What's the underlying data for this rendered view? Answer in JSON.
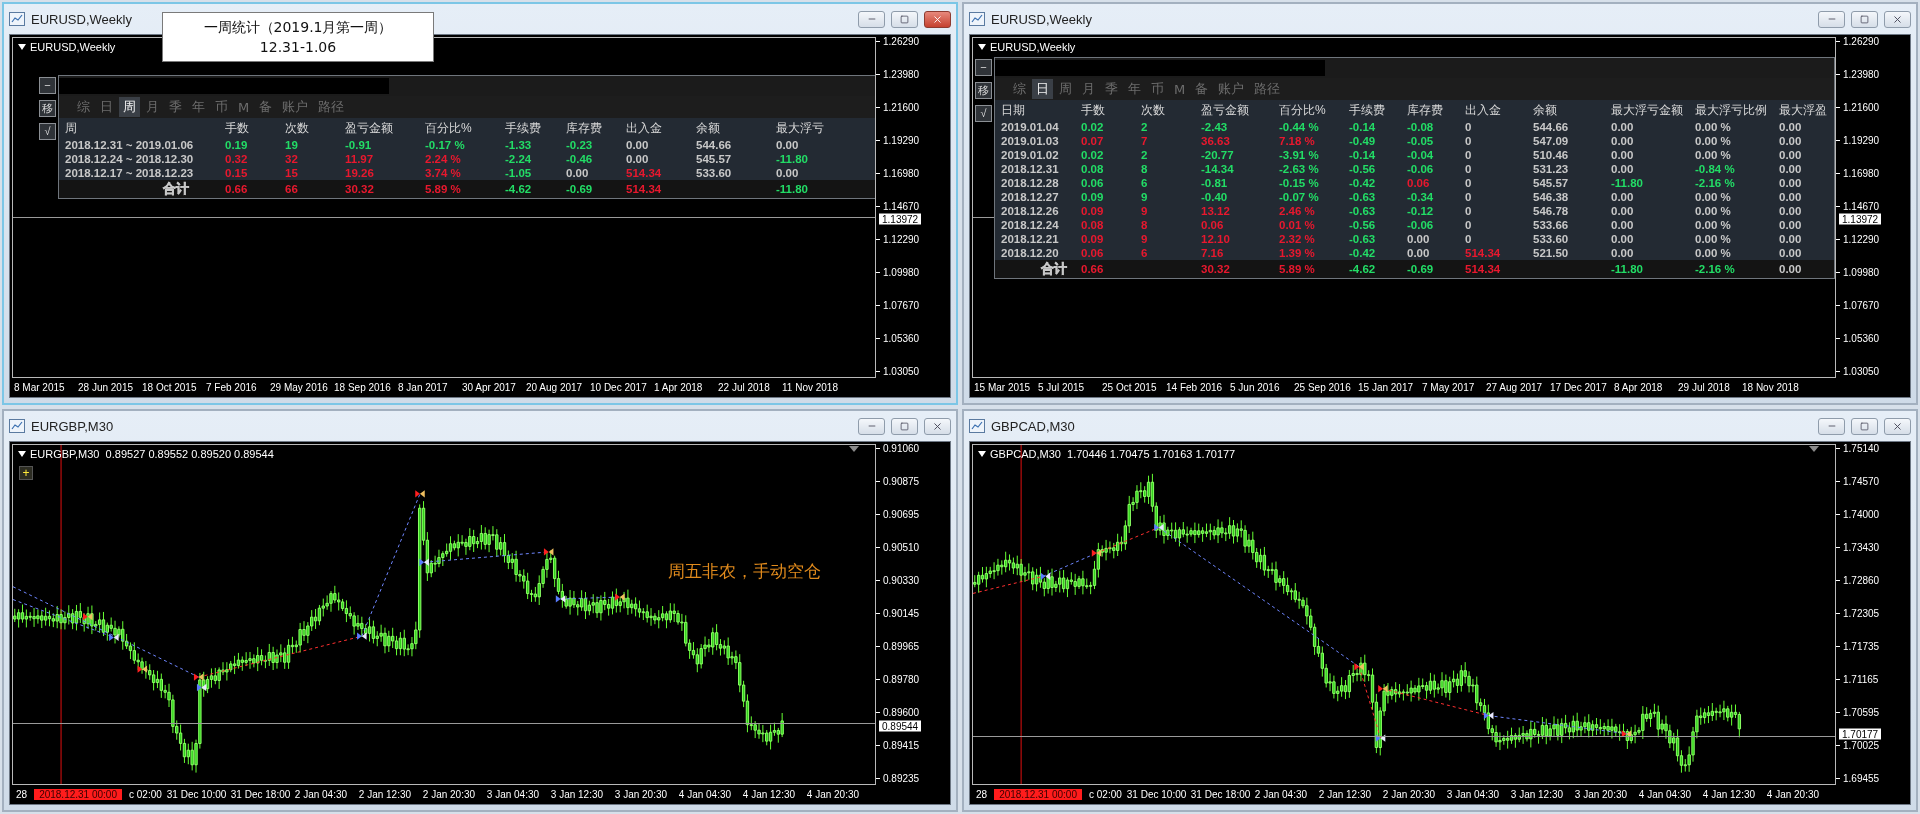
{
  "windows": [
    {
      "title": "EURUSD,Weekly",
      "active": true,
      "chart_label": "EURUSD,Weekly",
      "kind": "empty",
      "callout": {
        "lines": [
          "一周统计（2019.1月第一周）",
          "12.31-1.06"
        ]
      },
      "price_ticks": [
        "1.26290",
        "1.23980",
        "1.21600",
        "1.19290",
        "1.16980",
        "1.14670",
        "1.12290",
        "1.09980",
        "1.07670",
        "1.05360",
        "1.03050"
      ],
      "current_price": "1.13972",
      "time_ticks": [
        {
          "kind": "tick",
          "text": "8 Mar 2015"
        },
        {
          "kind": "tick",
          "text": "28 Jun 2015"
        },
        {
          "kind": "tick",
          "text": "18 Oct 2015"
        },
        {
          "kind": "tick",
          "text": "7 Feb 2016"
        },
        {
          "kind": "tick",
          "text": "29 May 2016"
        },
        {
          "kind": "tick",
          "text": "18 Sep 2016"
        },
        {
          "kind": "tick",
          "text": "8 Jan 2017"
        },
        {
          "kind": "tick",
          "text": "30 Apr 2017"
        },
        {
          "kind": "tick",
          "text": "20 Aug 2017"
        },
        {
          "kind": "tick",
          "text": "10 Dec 2017"
        },
        {
          "kind": "tick",
          "text": "1 Apr 2018"
        },
        {
          "kind": "tick",
          "text": "22 Jul 2018"
        },
        {
          "kind": "tick",
          "text": "11 Nov 2018"
        }
      ],
      "panel": {
        "side_buttons": [
          "−",
          "移",
          "√"
        ],
        "tabs": [
          {
            "label": "综",
            "selected": false
          },
          {
            "label": "日",
            "selected": false
          },
          {
            "label": "周",
            "selected": true
          },
          {
            "label": "月",
            "selected": false
          },
          {
            "label": "季",
            "selected": false
          },
          {
            "label": "年",
            "selected": false
          },
          {
            "label": "币",
            "selected": false
          },
          {
            "label": "M",
            "selected": false
          },
          {
            "label": "备",
            "selected": false
          },
          {
            "label": "账户",
            "selected": false
          },
          {
            "label": "路径",
            "selected": false
          }
        ],
        "columns": [
          "周",
          "手数",
          "次数",
          "盈亏金额",
          "百分比%",
          "手续费",
          "库存费",
          "出入金",
          "余额",
          "最大浮亏"
        ],
        "rows": [
          {
            "cells": [
              {
                "text": "2018.12.31 ~ 2019.01.06",
                "color": "#c8c8c8"
              },
              {
                "text": "0.19",
                "color": "#22dd66"
              },
              {
                "text": "19",
                "color": "#22dd66"
              },
              {
                "text": "-0.91",
                "color": "#22dd66"
              },
              {
                "text": "-0.17 %",
                "color": "#22dd66"
              },
              {
                "text": "-1.33",
                "color": "#22dd66"
              },
              {
                "text": "-0.23",
                "color": "#22dd66"
              },
              {
                "text": "0.00",
                "color": "#c8c8c8"
              },
              {
                "text": "544.66",
                "color": "#c8c8c8"
              },
              {
                "text": "0.00",
                "color": "#c8c8c8"
              }
            ]
          },
          {
            "cells": [
              {
                "text": "2018.12.24 ~ 2018.12.30",
                "color": "#c8c8c8"
              },
              {
                "text": "0.32",
                "color": "#e8182e"
              },
              {
                "text": "32",
                "color": "#e8182e"
              },
              {
                "text": "11.97",
                "color": "#e8182e"
              },
              {
                "text": "2.24 %",
                "color": "#e8182e"
              },
              {
                "text": "-2.24",
                "color": "#22dd66"
              },
              {
                "text": "-0.46",
                "color": "#22dd66"
              },
              {
                "text": "0.00",
                "color": "#c8c8c8"
              },
              {
                "text": "545.57",
                "color": "#c8c8c8"
              },
              {
                "text": "-11.80",
                "color": "#22dd66"
              }
            ]
          },
          {
            "cells": [
              {
                "text": "2018.12.17 ~ 2018.12.23",
                "color": "#c8c8c8"
              },
              {
                "text": "0.15",
                "color": "#e8182e"
              },
              {
                "text": "15",
                "color": "#e8182e"
              },
              {
                "text": "19.26",
                "color": "#e8182e"
              },
              {
                "text": "3.74 %",
                "color": "#e8182e"
              },
              {
                "text": "-1.05",
                "color": "#22dd66"
              },
              {
                "text": "0.00",
                "color": "#c8c8c8"
              },
              {
                "text": "514.34",
                "color": "#e8182e"
              },
              {
                "text": "533.60",
                "color": "#c8c8c8"
              },
              {
                "text": "0.00",
                "color": "#c8c8c8"
              }
            ]
          }
        ],
        "total": {
          "cells": [
            {
              "text": "合计",
              "color": "#c8c8c8"
            },
            {
              "text": "0.66",
              "color": "#e8182e"
            },
            {
              "text": "66",
              "color": "#e8182e"
            },
            {
              "text": "30.32",
              "color": "#e8182e"
            },
            {
              "text": "5.89 %",
              "color": "#e8182e"
            },
            {
              "text": "-4.62",
              "color": "#22dd66"
            },
            {
              "text": "-0.69",
              "color": "#22dd66"
            },
            {
              "text": "514.34",
              "color": "#e8182e"
            },
            null,
            {
              "text": "-11.80",
              "color": "#22dd66"
            }
          ]
        }
      }
    },
    {
      "title": "EURUSD,Weekly",
      "active": false,
      "chart_label": "EURUSD,Weekly",
      "kind": "empty",
      "price_ticks": [
        "1.26290",
        "1.23980",
        "1.21600",
        "1.19290",
        "1.16980",
        "1.14670",
        "1.12290",
        "1.09980",
        "1.07670",
        "1.05360",
        "1.03050"
      ],
      "current_price": "1.13972",
      "time_ticks": [
        {
          "kind": "tick",
          "text": "15 Mar 2015"
        },
        {
          "kind": "tick",
          "text": "5 Jul 2015"
        },
        {
          "kind": "tick",
          "text": "25 Oct 2015"
        },
        {
          "kind": "tick",
          "text": "14 Feb 2016"
        },
        {
          "kind": "tick",
          "text": "5 Jun 2016"
        },
        {
          "kind": "tick",
          "text": "25 Sep 2016"
        },
        {
          "kind": "tick",
          "text": "15 Jan 2017"
        },
        {
          "kind": "tick",
          "text": "7 May 2017"
        },
        {
          "kind": "tick",
          "text": "27 Aug 2017"
        },
        {
          "kind": "tick",
          "text": "17 Dec 2017"
        },
        {
          "kind": "tick",
          "text": "8 Apr 2018"
        },
        {
          "kind": "tick",
          "text": "29 Jul 2018"
        },
        {
          "kind": "tick",
          "text": "18 Nov 2018"
        }
      ],
      "panel": {
        "side_buttons": [
          "−",
          "移",
          "√"
        ],
        "tabs": [
          {
            "label": "综",
            "selected": false
          },
          {
            "label": "日",
            "selected": true
          },
          {
            "label": "周",
            "selected": false
          },
          {
            "label": "月",
            "selected": false
          },
          {
            "label": "季",
            "selected": false
          },
          {
            "label": "年",
            "selected": false
          },
          {
            "label": "币",
            "selected": false
          },
          {
            "label": "M",
            "selected": false
          },
          {
            "label": "备",
            "selected": false
          },
          {
            "label": "账户",
            "selected": false
          },
          {
            "label": "路径",
            "selected": false
          }
        ],
        "columns": [
          "日期",
          "手数",
          "次数",
          "盈亏金额",
          "百分比%",
          "手续费",
          "库存费",
          "出入金",
          "余额",
          "最大浮亏金额",
          "最大浮亏比例",
          "最大浮盈"
        ],
        "rows": [
          {
            "cells": [
              {
                "text": "2019.01.04",
                "color": "#c8c8c8"
              },
              {
                "text": "0.02",
                "color": "#22dd66"
              },
              {
                "text": "2",
                "color": "#22dd66"
              },
              {
                "text": "-2.43",
                "color": "#22dd66"
              },
              {
                "text": "-0.44 %",
                "color": "#22dd66"
              },
              {
                "text": "-0.14",
                "color": "#22dd66"
              },
              {
                "text": "-0.08",
                "color": "#22dd66"
              },
              {
                "text": "0",
                "color": "#c8c8c8"
              },
              {
                "text": "544.66",
                "color": "#c8c8c8"
              },
              {
                "text": "0.00",
                "color": "#c8c8c8"
              },
              {
                "text": "0.00 %",
                "color": "#c8c8c8"
              },
              {
                "text": "0.00",
                "color": "#c8c8c8"
              }
            ]
          },
          {
            "cells": [
              {
                "text": "2019.01.03",
                "color": "#c8c8c8"
              },
              {
                "text": "0.07",
                "color": "#e8182e"
              },
              {
                "text": "7",
                "color": "#e8182e"
              },
              {
                "text": "36.63",
                "color": "#e8182e"
              },
              {
                "text": "7.18 %",
                "color": "#e8182e"
              },
              {
                "text": "-0.49",
                "color": "#22dd66"
              },
              {
                "text": "-0.05",
                "color": "#22dd66"
              },
              {
                "text": "0",
                "color": "#c8c8c8"
              },
              {
                "text": "547.09",
                "color": "#c8c8c8"
              },
              {
                "text": "0.00",
                "color": "#c8c8c8"
              },
              {
                "text": "0.00 %",
                "color": "#c8c8c8"
              },
              {
                "text": "0.00",
                "color": "#c8c8c8"
              }
            ]
          },
          {
            "cells": [
              {
                "text": "2019.01.02",
                "color": "#c8c8c8"
              },
              {
                "text": "0.02",
                "color": "#22dd66"
              },
              {
                "text": "2",
                "color": "#22dd66"
              },
              {
                "text": "-20.77",
                "color": "#22dd66"
              },
              {
                "text": "-3.91 %",
                "color": "#22dd66"
              },
              {
                "text": "-0.14",
                "color": "#22dd66"
              },
              {
                "text": "-0.04",
                "color": "#22dd66"
              },
              {
                "text": "0",
                "color": "#c8c8c8"
              },
              {
                "text": "510.46",
                "color": "#c8c8c8"
              },
              {
                "text": "0.00",
                "color": "#c8c8c8"
              },
              {
                "text": "0.00 %",
                "color": "#c8c8c8"
              },
              {
                "text": "0.00",
                "color": "#c8c8c8"
              }
            ]
          },
          {
            "cells": [
              {
                "text": "2018.12.31",
                "color": "#c8c8c8"
              },
              {
                "text": "0.08",
                "color": "#22dd66"
              },
              {
                "text": "8",
                "color": "#22dd66"
              },
              {
                "text": "-14.34",
                "color": "#22dd66"
              },
              {
                "text": "-2.63 %",
                "color": "#22dd66"
              },
              {
                "text": "-0.56",
                "color": "#22dd66"
              },
              {
                "text": "-0.06",
                "color": "#22dd66"
              },
              {
                "text": "0",
                "color": "#c8c8c8"
              },
              {
                "text": "531.23",
                "color": "#c8c8c8"
              },
              {
                "text": "0.00",
                "color": "#c8c8c8"
              },
              {
                "text": "-0.84 %",
                "color": "#22dd66"
              },
              {
                "text": "0.00",
                "color": "#c8c8c8"
              }
            ]
          },
          {
            "cells": [
              {
                "text": "2018.12.28",
                "color": "#c8c8c8"
              },
              {
                "text": "0.06",
                "color": "#22dd66"
              },
              {
                "text": "6",
                "color": "#22dd66"
              },
              {
                "text": "-0.81",
                "color": "#22dd66"
              },
              {
                "text": "-0.15 %",
                "color": "#22dd66"
              },
              {
                "text": "-0.42",
                "color": "#22dd66"
              },
              {
                "text": "0.06",
                "color": "#e8182e"
              },
              {
                "text": "0",
                "color": "#c8c8c8"
              },
              {
                "text": "545.57",
                "color": "#c8c8c8"
              },
              {
                "text": "-11.80",
                "color": "#22dd66"
              },
              {
                "text": "-2.16 %",
                "color": "#22dd66"
              },
              {
                "text": "0.00",
                "color": "#c8c8c8"
              }
            ]
          },
          {
            "cells": [
              {
                "text": "2018.12.27",
                "color": "#c8c8c8"
              },
              {
                "text": "0.09",
                "color": "#22dd66"
              },
              {
                "text": "9",
                "color": "#22dd66"
              },
              {
                "text": "-0.40",
                "color": "#22dd66"
              },
              {
                "text": "-0.07 %",
                "color": "#22dd66"
              },
              {
                "text": "-0.63",
                "color": "#22dd66"
              },
              {
                "text": "-0.34",
                "color": "#22dd66"
              },
              {
                "text": "0",
                "color": "#c8c8c8"
              },
              {
                "text": "546.38",
                "color": "#c8c8c8"
              },
              {
                "text": "0.00",
                "color": "#c8c8c8"
              },
              {
                "text": "0.00 %",
                "color": "#c8c8c8"
              },
              {
                "text": "0.00",
                "color": "#c8c8c8"
              }
            ]
          },
          {
            "cells": [
              {
                "text": "2018.12.26",
                "color": "#c8c8c8"
              },
              {
                "text": "0.09",
                "color": "#e8182e"
              },
              {
                "text": "9",
                "color": "#e8182e"
              },
              {
                "text": "13.12",
                "color": "#e8182e"
              },
              {
                "text": "2.46 %",
                "color": "#e8182e"
              },
              {
                "text": "-0.63",
                "color": "#22dd66"
              },
              {
                "text": "-0.12",
                "color": "#22dd66"
              },
              {
                "text": "0",
                "color": "#c8c8c8"
              },
              {
                "text": "546.78",
                "color": "#c8c8c8"
              },
              {
                "text": "0.00",
                "color": "#c8c8c8"
              },
              {
                "text": "0.00 %",
                "color": "#c8c8c8"
              },
              {
                "text": "0.00",
                "color": "#c8c8c8"
              }
            ]
          },
          {
            "cells": [
              {
                "text": "2018.12.24",
                "color": "#c8c8c8"
              },
              {
                "text": "0.08",
                "color": "#e8182e"
              },
              {
                "text": "8",
                "color": "#e8182e"
              },
              {
                "text": "0.06",
                "color": "#e8182e"
              },
              {
                "text": "0.01 %",
                "color": "#e8182e"
              },
              {
                "text": "-0.56",
                "color": "#22dd66"
              },
              {
                "text": "-0.06",
                "color": "#22dd66"
              },
              {
                "text": "0",
                "color": "#c8c8c8"
              },
              {
                "text": "533.66",
                "color": "#c8c8c8"
              },
              {
                "text": "0.00",
                "color": "#c8c8c8"
              },
              {
                "text": "0.00 %",
                "color": "#c8c8c8"
              },
              {
                "text": "0.00",
                "color": "#c8c8c8"
              }
            ]
          },
          {
            "cells": [
              {
                "text": "2018.12.21",
                "color": "#c8c8c8"
              },
              {
                "text": "0.09",
                "color": "#e8182e"
              },
              {
                "text": "9",
                "color": "#e8182e"
              },
              {
                "text": "12.10",
                "color": "#e8182e"
              },
              {
                "text": "2.32 %",
                "color": "#e8182e"
              },
              {
                "text": "-0.63",
                "color": "#22dd66"
              },
              {
                "text": "0.00",
                "color": "#c8c8c8"
              },
              {
                "text": "0",
                "color": "#c8c8c8"
              },
              {
                "text": "533.60",
                "color": "#c8c8c8"
              },
              {
                "text": "0.00",
                "color": "#c8c8c8"
              },
              {
                "text": "0.00 %",
                "color": "#c8c8c8"
              },
              {
                "text": "0.00",
                "color": "#c8c8c8"
              }
            ]
          },
          {
            "cells": [
              {
                "text": "2018.12.20",
                "color": "#c8c8c8"
              },
              {
                "text": "0.06",
                "color": "#e8182e"
              },
              {
                "text": "6",
                "color": "#e8182e"
              },
              {
                "text": "7.16",
                "color": "#e8182e"
              },
              {
                "text": "1.39 %",
                "color": "#e8182e"
              },
              {
                "text": "-0.42",
                "color": "#22dd66"
              },
              {
                "text": "0.00",
                "color": "#c8c8c8"
              },
              {
                "text": "514.34",
                "color": "#e8182e"
              },
              {
                "text": "521.50",
                "color": "#c8c8c8"
              },
              {
                "text": "0.00",
                "color": "#c8c8c8"
              },
              {
                "text": "0.00 %",
                "color": "#c8c8c8"
              },
              {
                "text": "0.00",
                "color": "#c8c8c8"
              }
            ]
          }
        ],
        "total": {
          "cells": [
            {
              "text": "合计",
              "color": "#c8c8c8"
            },
            {
              "text": "0.66",
              "color": "#e8182e"
            },
            null,
            {
              "text": "30.32",
              "color": "#e8182e"
            },
            {
              "text": "5.89 %",
              "color": "#e8182e"
            },
            {
              "text": "-4.62",
              "color": "#22dd66"
            },
            {
              "text": "-0.69",
              "color": "#22dd66"
            },
            {
              "text": "514.34",
              "color": "#e8182e"
            },
            null,
            {
              "text": "-11.80",
              "color": "#22dd66"
            },
            {
              "text": "-2.16 %",
              "color": "#22dd66"
            },
            {
              "text": "0.00",
              "color": "#c8c8c8"
            }
          ]
        }
      }
    },
    {
      "title": "EURGBP,M30",
      "active": false,
      "chart_label": "EURGBP,M30  0.89527 0.89552 0.89520 0.89544",
      "kind": "candles",
      "plus_button": "+",
      "note": "周五非农，手动空仓",
      "price_ticks": [
        "0.91060",
        "0.90875",
        "0.90695",
        "0.90510",
        "0.90330",
        "0.90145",
        "0.89965",
        "0.89780",
        "0.89600",
        "0.89415",
        "0.89235"
      ],
      "current_price": "0.89544",
      "time_ticks": [
        {
          "kind": "partial",
          "text": "28"
        },
        {
          "kind": "marker",
          "text": "2018.12.31 00:00"
        },
        {
          "kind": "partial",
          "text": "c 02:00"
        },
        {
          "kind": "tick",
          "text": "31 Dec 10:00"
        },
        {
          "kind": "tick",
          "text": "31 Dec 18:00"
        },
        {
          "kind": "tick",
          "text": "2 Jan 04:30"
        },
        {
          "kind": "tick",
          "text": "2 Jan 12:30"
        },
        {
          "kind": "tick",
          "text": "2 Jan 20:30"
        },
        {
          "kind": "tick",
          "text": "3 Jan 04:30"
        },
        {
          "kind": "tick",
          "text": "3 Jan 12:30"
        },
        {
          "kind": "tick",
          "text": "3 Jan 20:30"
        },
        {
          "kind": "tick",
          "text": "4 Jan 04:30"
        },
        {
          "kind": "tick",
          "text": "4 Jan 12:30"
        },
        {
          "kind": "tick",
          "text": "4 Jan 20:30"
        }
      ]
    },
    {
      "title": "GBPCAD,M30",
      "active": false,
      "chart_label": "GBPCAD,M30  1.70446 1.70475 1.70163 1.70177",
      "kind": "candles",
      "price_ticks": [
        "1.75140",
        "1.74570",
        "1.74000",
        "1.73430",
        "1.72860",
        "1.72305",
        "1.71735",
        "1.71165",
        "1.70595",
        "1.70025",
        "1.69455"
      ],
      "current_price": "1.70177",
      "time_ticks": [
        {
          "kind": "partial",
          "text": "28"
        },
        {
          "kind": "marker",
          "text": "2018.12.31 00:00"
        },
        {
          "kind": "partial",
          "text": "c 02:00"
        },
        {
          "kind": "tick",
          "text": "31 Dec 10:00"
        },
        {
          "kind": "tick",
          "text": "31 Dec 18:00"
        },
        {
          "kind": "tick",
          "text": "2 Jan 04:30"
        },
        {
          "kind": "tick",
          "text": "2 Jan 12:30"
        },
        {
          "kind": "tick",
          "text": "2 Jan 20:30"
        },
        {
          "kind": "tick",
          "text": "3 Jan 04:30"
        },
        {
          "kind": "tick",
          "text": "3 Jan 12:30"
        },
        {
          "kind": "tick",
          "text": "3 Jan 20:30"
        },
        {
          "kind": "tick",
          "text": "4 Jan 04:30"
        },
        {
          "kind": "tick",
          "text": "4 Jan 12:30"
        },
        {
          "kind": "tick",
          "text": "4 Jan 20:30"
        }
      ]
    }
  ]
}
